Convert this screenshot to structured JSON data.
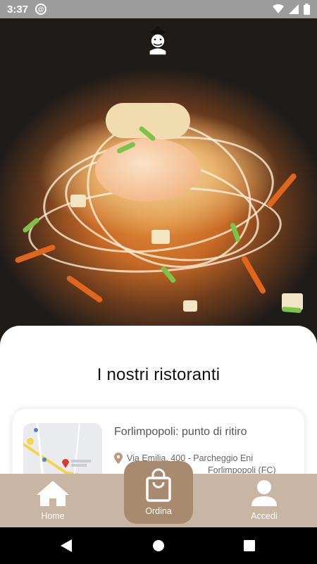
{
  "status_bar": {
    "time": "3:37",
    "at_symbol": "@"
  },
  "page": {
    "title": "I nostri ristoranti"
  },
  "restaurant_card": {
    "title": "Forlimpopoli: punto di ritiro",
    "address_line1": "Via Emilia, 400 - Parcheggio Eni",
    "address_line2": "Forlimpopoli (FC)"
  },
  "nav": {
    "home_label": "Home",
    "order_label": "Ordina",
    "login_label": "Accedi"
  },
  "colors": {
    "navbar": "#c9b5a3",
    "order_button": "#a88a6f",
    "status_bar": "#9c9c9c"
  }
}
